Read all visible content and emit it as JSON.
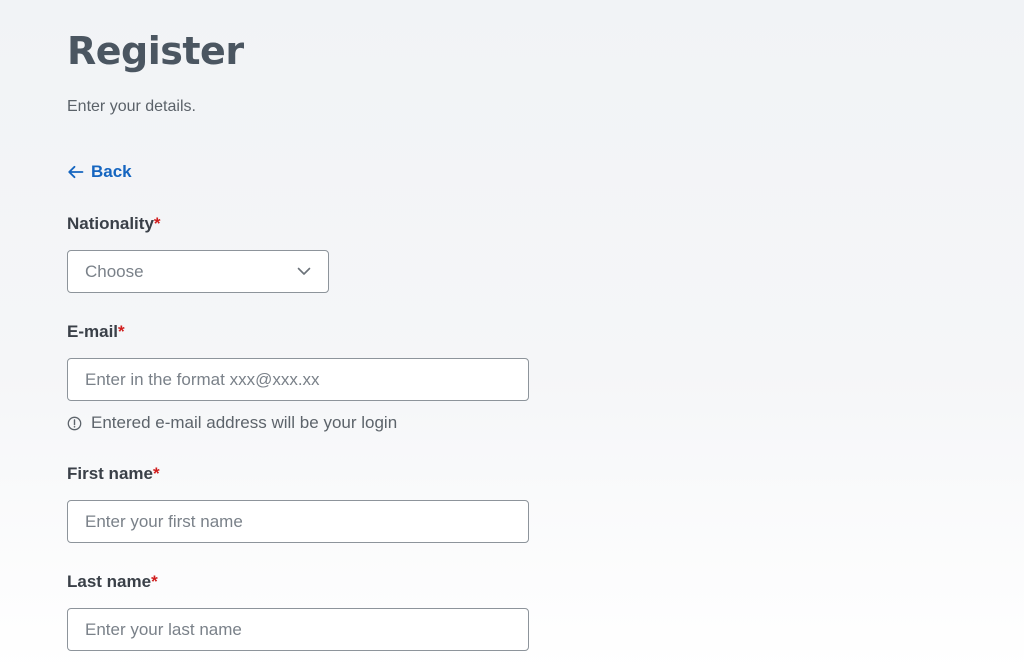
{
  "header": {
    "title": "Register",
    "subtitle": "Enter your details."
  },
  "back_link": {
    "label": "Back",
    "icon": "arrow-left-icon"
  },
  "form": {
    "required_marker": "*",
    "nationality": {
      "label": "Nationality",
      "value": "Choose",
      "icon": "chevron-down-icon"
    },
    "email": {
      "label": "E-mail",
      "placeholder": "Enter in the format xxx@xxx.xx",
      "hint": "Entered e-mail address will be your login",
      "hint_icon": "info-icon"
    },
    "first_name": {
      "label": "First name",
      "placeholder": "Enter your first name"
    },
    "last_name": {
      "label": "Last name",
      "placeholder": "Enter your last name"
    }
  },
  "colors": {
    "link": "#1565c0",
    "required": "#d01c1c",
    "title": "#4b5661",
    "border": "#8d949b"
  }
}
